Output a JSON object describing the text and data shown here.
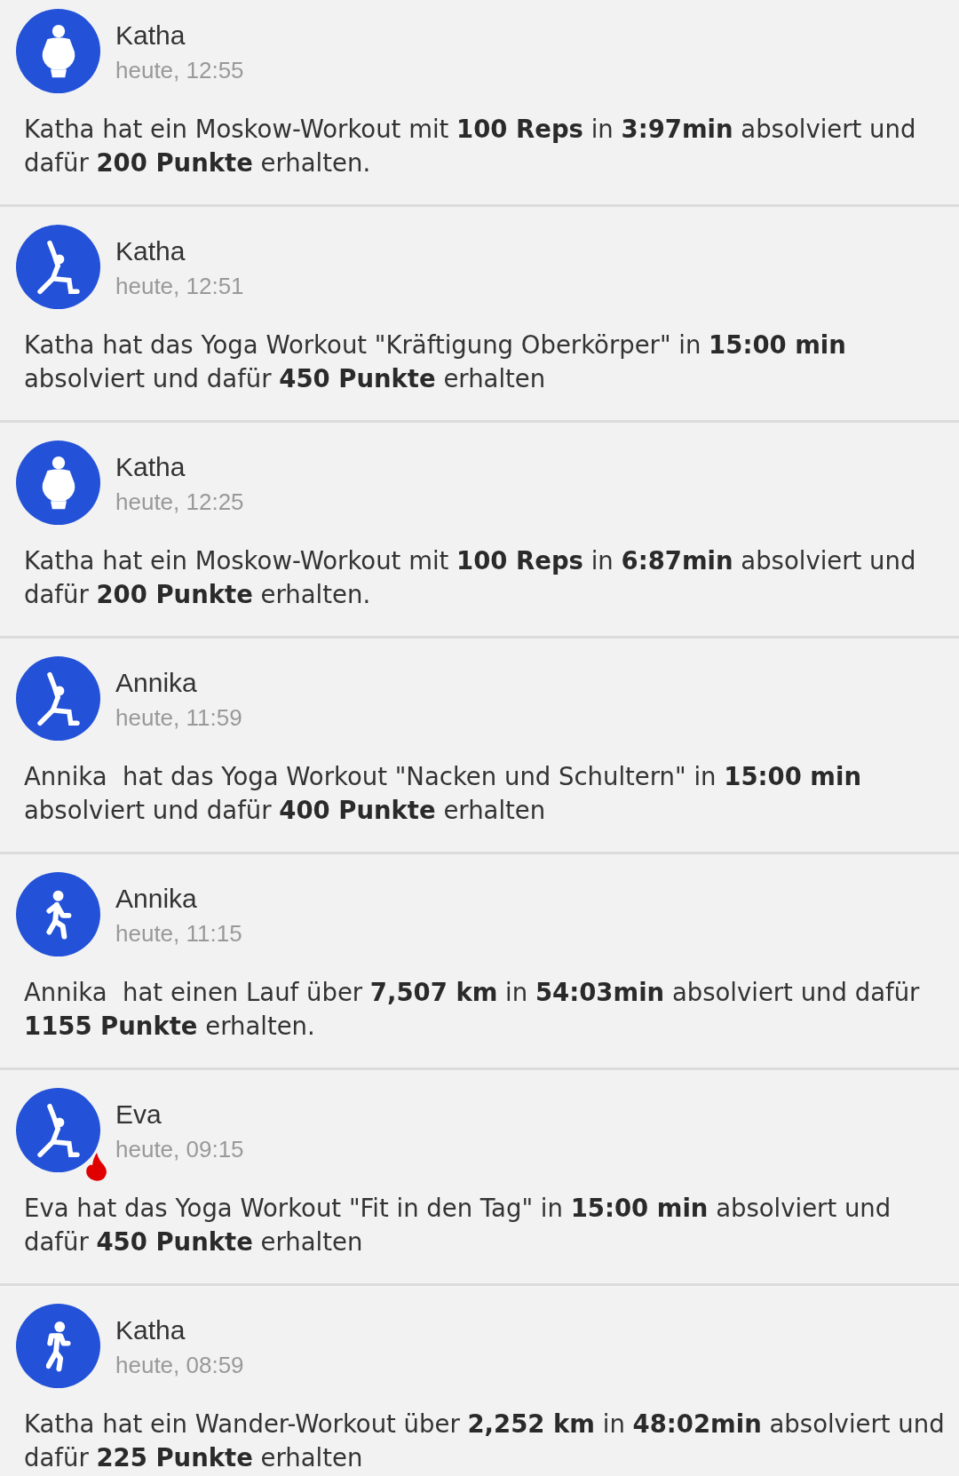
{
  "feed": [
    {
      "name": "Katha",
      "time": "heute, 12:55",
      "kind": "strength",
      "flame": false,
      "message": "Katha hat ein Moskow-Workout mit **100 Reps** in **3:97min** absolviert und dafür **200 Punkte** erhalten."
    },
    {
      "name": "Katha",
      "time": "heute, 12:51",
      "kind": "yoga",
      "flame": false,
      "message": "Katha hat das Yoga Workout \"Kräftigung Oberkörper\" in **15:00 min** absolviert und dafür **450 Punkte** erhalten"
    },
    {
      "name": "Katha",
      "time": "heute, 12:25",
      "kind": "strength",
      "flame": false,
      "message": "Katha hat ein Moskow-Workout mit **100 Reps** in **6:87min** absolviert und dafür **200 Punkte** erhalten."
    },
    {
      "name": "Annika",
      "time": "heute, 11:59",
      "kind": "yoga",
      "flame": false,
      "message": "Annika  hat das Yoga Workout \"Nacken und Schultern\" in **15:00 min** absolviert und dafür **400 Punkte** erhalten"
    },
    {
      "name": "Annika",
      "time": "heute, 11:15",
      "kind": "run",
      "flame": false,
      "message": "Annika  hat einen Lauf über **7,507 km** in **54:03min** absolviert und dafür **1155 Punkte** erhalten."
    },
    {
      "name": "Eva",
      "time": "heute, 09:15",
      "kind": "yoga",
      "flame": true,
      "message": "Eva hat das Yoga Workout \"Fit in den Tag\" in **15:00 min** absolviert und dafür **450 Punkte** erhalten"
    },
    {
      "name": "Katha",
      "time": "heute, 08:59",
      "kind": "hike",
      "flame": false,
      "message": "Katha hat ein Wander-Workout über **2,252 km** in **48:02min** absolviert und dafür **225 Punkte** erhalten"
    }
  ]
}
